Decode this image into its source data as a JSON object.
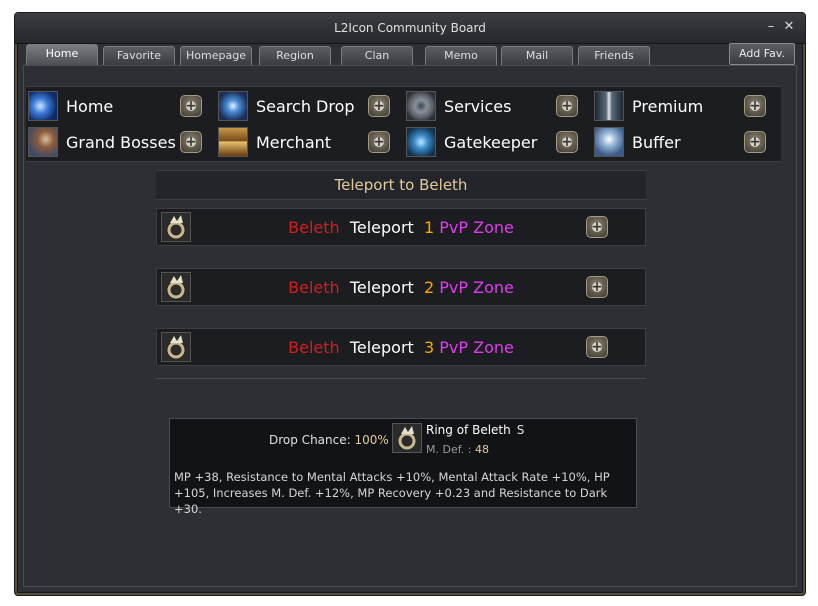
{
  "window": {
    "title": "L2Icon Community Board",
    "minimize": "–",
    "close": "✕"
  },
  "tabs": [
    "Home",
    "Favorite",
    "Homepage",
    "Region",
    "Clan",
    "Memo",
    "Mail",
    "Friends"
  ],
  "add_fav": "Add Fav.",
  "menu": [
    {
      "label": "Home",
      "icon": "star-burst-icon"
    },
    {
      "label": "Search Drop",
      "icon": "magic-icon"
    },
    {
      "label": "Services",
      "icon": "gear-icon"
    },
    {
      "label": "Premium",
      "icon": "sword-icon"
    },
    {
      "label": "Grand Bosses",
      "icon": "dragon-icon"
    },
    {
      "label": "Merchant",
      "icon": "chest-icon"
    },
    {
      "label": "Gatekeeper",
      "icon": "portal-icon"
    },
    {
      "label": "Buffer",
      "icon": "angel-icon"
    }
  ],
  "section_title": "Teleport to Beleth",
  "teleports": [
    {
      "boss": "Beleth",
      "word": "Teleport",
      "num": "1",
      "zone": "PvP Zone"
    },
    {
      "boss": "Beleth",
      "word": "Teleport",
      "num": "2",
      "zone": "PvP Zone"
    },
    {
      "boss": "Beleth",
      "word": "Teleport",
      "num": "3",
      "zone": "PvP Zone"
    }
  ],
  "item": {
    "drop_label": "Drop Chance:",
    "drop_value": "100%",
    "name": "Ring of Beleth",
    "grade": "S",
    "def_label": "M. Def. :",
    "def_value": "48",
    "description": "MP +38, Resistance to Mental Attacks +10%, Mental Attack Rate +10%, HP +105, Increases M. Def. +12%, MP Recovery +0.23 and Resistance to Dark +30."
  },
  "colors": {
    "boss": "#d21e1e",
    "number": "#ffa500",
    "zone": "#e03cf0",
    "title": "#e5c99a"
  }
}
